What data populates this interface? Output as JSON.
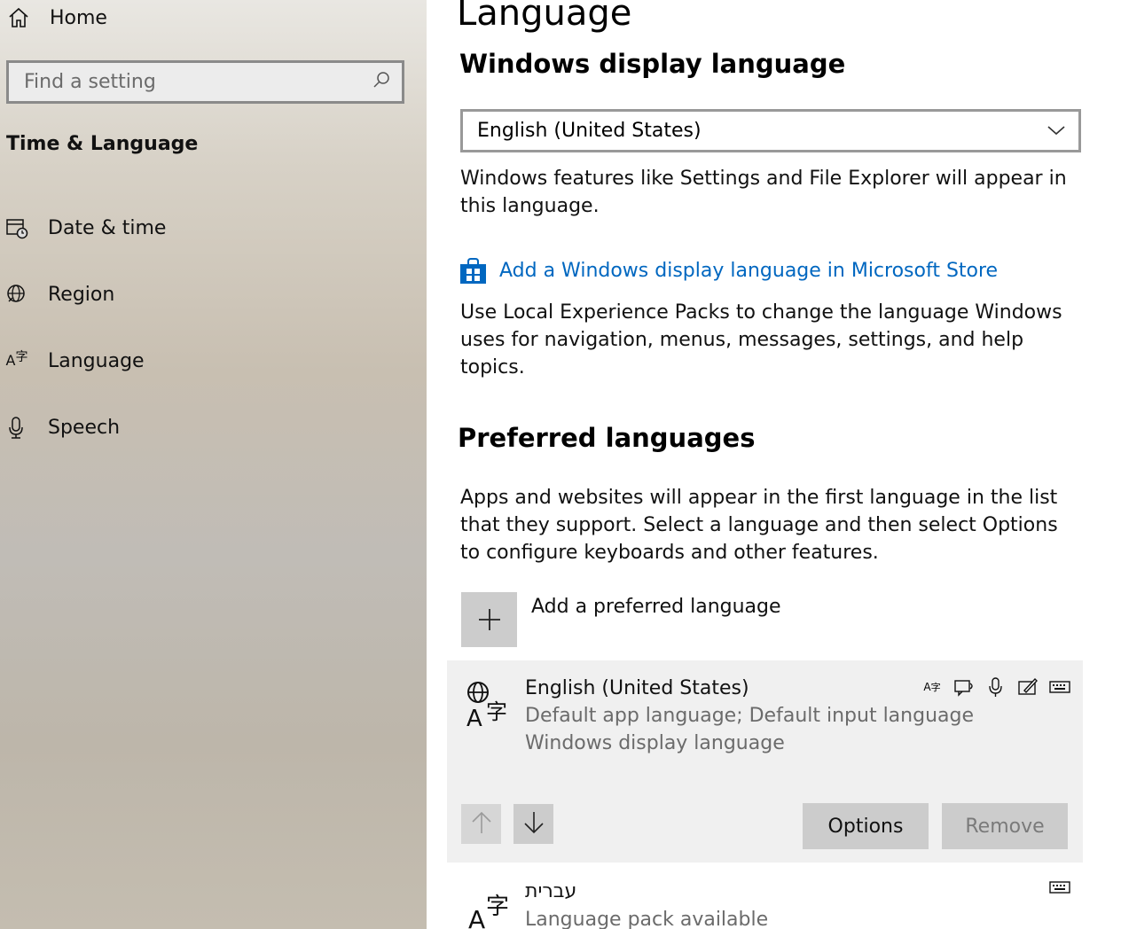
{
  "sidebar": {
    "home_label": "Home",
    "search_placeholder": "Find a setting",
    "section_title": "Time & Language",
    "items": [
      {
        "label": "Date & time",
        "icon": "calendar-clock-icon"
      },
      {
        "label": "Region",
        "icon": "globe-icon"
      },
      {
        "label": "Language",
        "icon": "language-icon"
      },
      {
        "label": "Speech",
        "icon": "microphone-icon"
      }
    ]
  },
  "main": {
    "title": "Language",
    "display_language": {
      "heading": "Windows display language",
      "selected": "English (United States)",
      "description": "Windows features like Settings and File Explorer will appear in this language.",
      "store_link": "Add a Windows display language in Microsoft Store",
      "store_description": "Use Local Experience Packs to change the language Windows uses for navigation, menus, messages, settings, and help topics."
    },
    "preferred": {
      "heading": "Preferred languages",
      "description": "Apps and websites will appear in the first language in the list that they support. Select a language and then select Options to configure keyboards and other features.",
      "add_label": "Add a preferred language",
      "languages": [
        {
          "name": "English (United States)",
          "line1": "Default app language; Default input language",
          "line2": "Windows display language",
          "features": [
            "language-pack-icon",
            "text-to-speech-icon",
            "speech-recognition-icon",
            "handwriting-icon",
            "keyboard-icon"
          ],
          "options_label": "Options",
          "remove_label": "Remove"
        },
        {
          "name": "עברית",
          "line1": "Language pack available",
          "features": [
            "keyboard-icon"
          ]
        }
      ]
    }
  },
  "colors": {
    "link": "#0067c0",
    "button_bg": "#cccccc",
    "card_bg": "#f0f0f0",
    "secondary_text": "#6b6b6b"
  }
}
